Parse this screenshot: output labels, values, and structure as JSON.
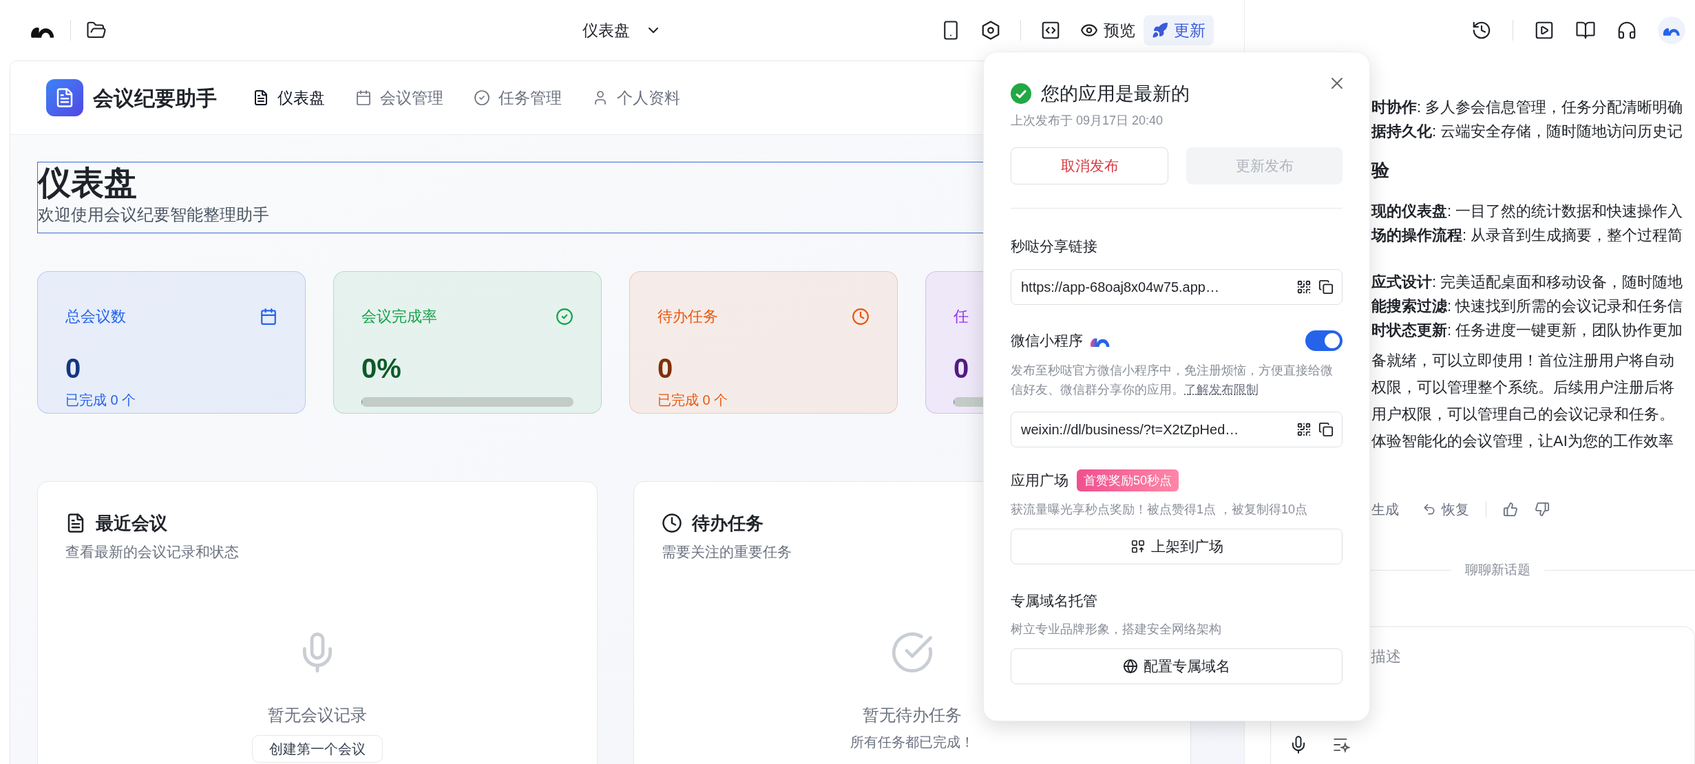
{
  "toolbar": {
    "page_selector": "仪表盘",
    "preview": "预览",
    "update": "更新"
  },
  "app": {
    "title": "会议纪要助手",
    "nav": [
      {
        "label": "仪表盘",
        "selected": true
      },
      {
        "label": "会议管理",
        "selected": false
      },
      {
        "label": "任务管理",
        "selected": false
      },
      {
        "label": "个人资料",
        "selected": false
      }
    ]
  },
  "page": {
    "title": "仪表盘",
    "subtitle": "欢迎使用会议纪要智能整理助手"
  },
  "stats": [
    {
      "kind": "count",
      "label": "总会议数",
      "value": "0",
      "note": "已完成 0 个",
      "color": "#2563eb"
    },
    {
      "kind": "rate",
      "label": "会议完成率",
      "value": "0%",
      "level": 0,
      "color": "#16a34a"
    },
    {
      "kind": "count",
      "label": "待办任务",
      "value": "0",
      "note": "已完成 0 个",
      "color": "#ea580c"
    },
    {
      "kind": "rate",
      "label": "任",
      "value": "0",
      "level": 0,
      "color": "#9333ea"
    }
  ],
  "panels": [
    {
      "title": "最近会议",
      "subtitle": "查看最新的会议记录和状态",
      "empty_title": "暂无会议记录",
      "action": "创建第一个会议"
    },
    {
      "title": "待办任务",
      "subtitle": "需要关注的重要任务",
      "empty_title": "暂无待办任务",
      "empty_note": "所有任务都已完成！"
    }
  ],
  "publish_popup": {
    "title": "您的应用是最新的",
    "last_published": "上次发布于 09月17日 20:40",
    "unpublish": "取消发布",
    "republish": {
      "label": "更新发布",
      "disabled": true
    },
    "share": {
      "label": "秒哒分享链接",
      "url": "https://app-68oaj8x04w75.app…"
    },
    "mini_program": {
      "label": "微信小程序",
      "on": true,
      "description": "发布至秒哒官方微信小程序中，免注册烦恼，方便直接给微信好友、微信群分享你的应用。",
      "link": "了解发布限制",
      "url": "weixin://dl/business/?t=X2tZpHed…"
    },
    "plaza": {
      "label": "应用广场",
      "badge": "首赞奖励50秒点",
      "description": "获流量曝光享秒点奖励！被点赞得1点 ，被复制得10点",
      "button": "上架到广场"
    },
    "domain": {
      "label": "专属域名托管",
      "description": "树立专业品牌形象，搭建安全网络架构",
      "button": "配置专属域名"
    }
  },
  "chat": {
    "blocks": [
      {
        "kind": "list",
        "lines": [
          "**时协作**: 多人参会信息管理，任务分配清晰明确",
          "**据持久化**: 云端安全存储，随时随地访问历史记"
        ]
      },
      {
        "kind": "heading",
        "lines": [
          "验"
        ]
      },
      {
        "kind": "list",
        "lines": [
          "**现的仪表盘**: 一目了然的统计数据和快速操作入",
          "**场的操作流程**: 从录音到生成摘要，整个过程简"
        ]
      },
      {
        "kind": "list",
        "lines": [
          "**应式设计**: 完美适配桌面和移动设备，随时随地",
          "**能搜索过滤**: 快速找到所需的会议记录和任务信",
          "**时状态更新**: 任务进度一键更新，团队协作更加"
        ]
      },
      {
        "kind": "paragraph",
        "lines": [
          "备就绪，可以立即使用！首位注册用户将自动",
          "权限，可以管理整个系统。后续用户注册后将",
          "用户权限，可以管理自己的会议记录和任务。",
          "体验智能化的会议管理，让AI为您的工作效率"
        ]
      }
    ],
    "actions": {
      "regenerate": "生成",
      "restore": "恢复"
    },
    "divider": "聊聊新话题",
    "input": {
      "placeholder": "描述"
    }
  }
}
